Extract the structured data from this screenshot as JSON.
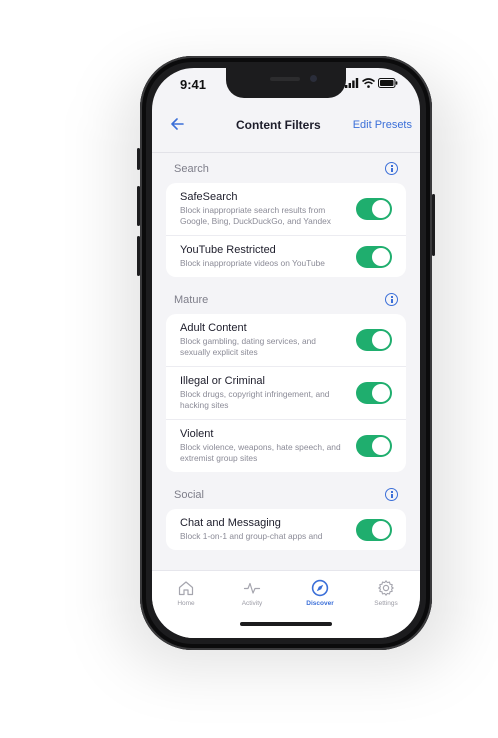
{
  "status_bar": {
    "time": "9:41"
  },
  "header": {
    "title": "Content Filters",
    "edit_presets": "Edit Presets"
  },
  "sections": [
    {
      "title": "Search",
      "rows": [
        {
          "title": "SafeSearch",
          "desc": "Block inappropriate search results from Google, Bing, DuckDuckGo, and Yandex",
          "enabled": true
        },
        {
          "title": "YouTube Restricted",
          "desc": "Block inappropriate videos on YouTube",
          "enabled": true
        }
      ]
    },
    {
      "title": "Mature",
      "rows": [
        {
          "title": "Adult Content",
          "desc": "Block gambling, dating services, and sexually explicit sites",
          "enabled": true
        },
        {
          "title": "Illegal or Criminal",
          "desc": "Block drugs, copyright infringement, and hacking sites",
          "enabled": true
        },
        {
          "title": "Violent",
          "desc": "Block violence, weapons, hate speech, and extremist group sites",
          "enabled": true
        }
      ]
    },
    {
      "title": "Social",
      "rows": [
        {
          "title": "Chat and Messaging",
          "desc": "Block 1-on-1 and group-chat apps and",
          "enabled": true
        }
      ]
    }
  ],
  "tabs": [
    {
      "label": "Home",
      "icon": "home-icon"
    },
    {
      "label": "Activity",
      "icon": "activity-icon"
    },
    {
      "label": "Discover",
      "icon": "compass-icon",
      "active": true
    },
    {
      "label": "Settings",
      "icon": "gear-icon"
    }
  ],
  "colors": {
    "accent": "#3b6fd8",
    "toggle_on": "#1fae6e",
    "screen_bg": "#f4f4f7"
  }
}
